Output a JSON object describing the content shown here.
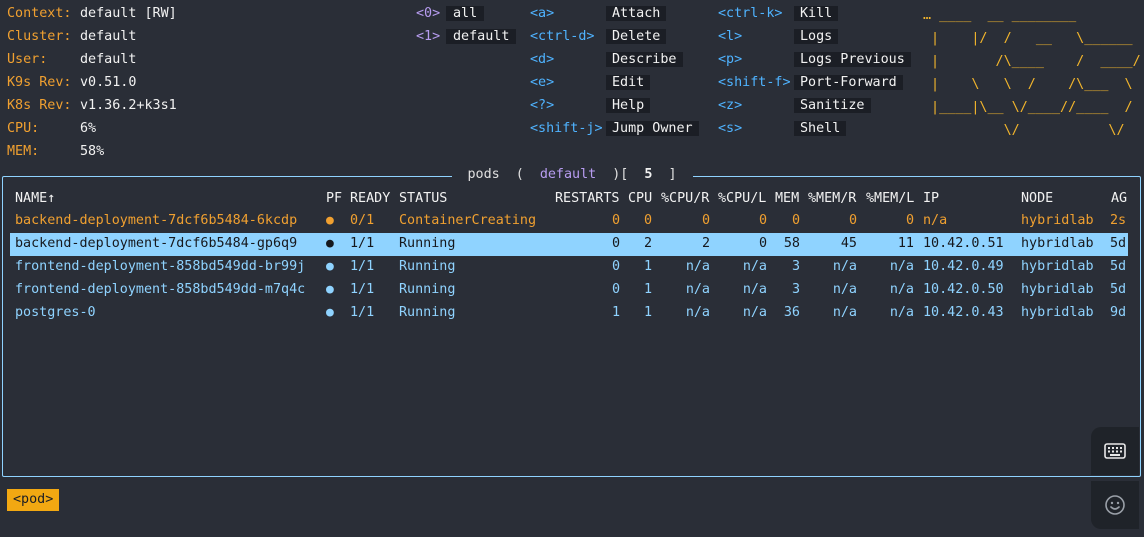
{
  "info": [
    {
      "label": "Context:",
      "value": "default [RW]"
    },
    {
      "label": "Cluster:",
      "value": "default"
    },
    {
      "label": "User:",
      "value": "default"
    },
    {
      "label": "K9s Rev:",
      "value": "v0.51.0"
    },
    {
      "label": "K8s Rev:",
      "value": "v1.36.2+k3s1"
    },
    {
      "label": "CPU:",
      "value": "6%"
    },
    {
      "label": "MEM:",
      "value": "58%"
    }
  ],
  "namespaces": [
    {
      "key": "<0>",
      "name": "all"
    },
    {
      "key": "<1>",
      "name": "default"
    }
  ],
  "shortcuts": {
    "col1": [
      {
        "key": "<a>",
        "label": "Attach"
      },
      {
        "key": "<ctrl-d>",
        "label": "Delete"
      },
      {
        "key": "<d>",
        "label": "Describe"
      },
      {
        "key": "<e>",
        "label": "Edit"
      },
      {
        "key": "<?>",
        "label": "Help"
      },
      {
        "key": "<shift-j>",
        "label": "Jump Owner"
      }
    ],
    "col2": [
      {
        "key": "<ctrl-k>",
        "label": "Kill"
      },
      {
        "key": "<l>",
        "label": "Logs"
      },
      {
        "key": "<p>",
        "label": "Logs Previous"
      },
      {
        "key": "<shift-f>",
        "label": "Port-Forward"
      },
      {
        "key": "<z>",
        "label": "Sanitize"
      },
      {
        "key": "<s>",
        "label": "Shell"
      }
    ]
  },
  "table": {
    "title_resource": "pods",
    "title_namespace": "default",
    "title_count": "5",
    "headers": {
      "name": "NAME↑",
      "pf": "PF",
      "ready": "READY",
      "status": "STATUS",
      "restarts": "RESTARTS",
      "cpu": "CPU",
      "cpu_r": "%CPU/R",
      "cpu_l": "%CPU/L",
      "mem": "MEM",
      "mem_r": "%MEM/R",
      "mem_l": "%MEM/L",
      "ip": "IP",
      "node": "NODE",
      "age": "AG"
    },
    "rows": [
      {
        "name": "backend-deployment-7dcf6b5484-6kcdp",
        "pf": "●",
        "ready": "0/1",
        "status": "ContainerCreating",
        "restarts": "0",
        "cpu": "0",
        "cpu_r": "0",
        "cpu_l": "0",
        "mem": "0",
        "mem_r": "0",
        "mem_l": "0",
        "ip": "n/a",
        "node": "hybridlab",
        "age": "2s"
      },
      {
        "name": "backend-deployment-7dcf6b5484-gp6q9",
        "pf": "●",
        "ready": "1/1",
        "status": "Running",
        "restarts": "0",
        "cpu": "2",
        "cpu_r": "2",
        "cpu_l": "0",
        "mem": "58",
        "mem_r": "45",
        "mem_l": "11",
        "ip": "10.42.0.51",
        "node": "hybridlab",
        "age": "5d"
      },
      {
        "name": "frontend-deployment-858bd549dd-br99j",
        "pf": "●",
        "ready": "1/1",
        "status": "Running",
        "restarts": "0",
        "cpu": "1",
        "cpu_r": "n/a",
        "cpu_l": "n/a",
        "mem": "3",
        "mem_r": "n/a",
        "mem_l": "n/a",
        "ip": "10.42.0.49",
        "node": "hybridlab",
        "age": "5d"
      },
      {
        "name": "frontend-deployment-858bd549dd-m7q4c",
        "pf": "●",
        "ready": "1/1",
        "status": "Running",
        "restarts": "0",
        "cpu": "1",
        "cpu_r": "n/a",
        "cpu_l": "n/a",
        "mem": "3",
        "mem_r": "n/a",
        "mem_l": "n/a",
        "ip": "10.42.0.50",
        "node": "hybridlab",
        "age": "5d"
      },
      {
        "name": "postgres-0",
        "pf": "●",
        "ready": "1/1",
        "status": "Running",
        "restarts": "1",
        "cpu": "1",
        "cpu_r": "n/a",
        "cpu_l": "n/a",
        "mem": "36",
        "mem_r": "n/a",
        "mem_l": "n/a",
        "ip": "10.42.0.43",
        "node": "hybridlab",
        "age": "9d"
      }
    ]
  },
  "breadcrumb": "<pod>",
  "icons": {
    "keyboard": "keyboard-icon",
    "emoji": "smiley-icon"
  },
  "colors": {
    "accent_orange": "#f0a030",
    "frame_cyan": "#8fd3ff",
    "key_blue": "#4fb3ff",
    "ns_purple": "#b79cf0",
    "logo_yellow": "#f2b52c"
  }
}
